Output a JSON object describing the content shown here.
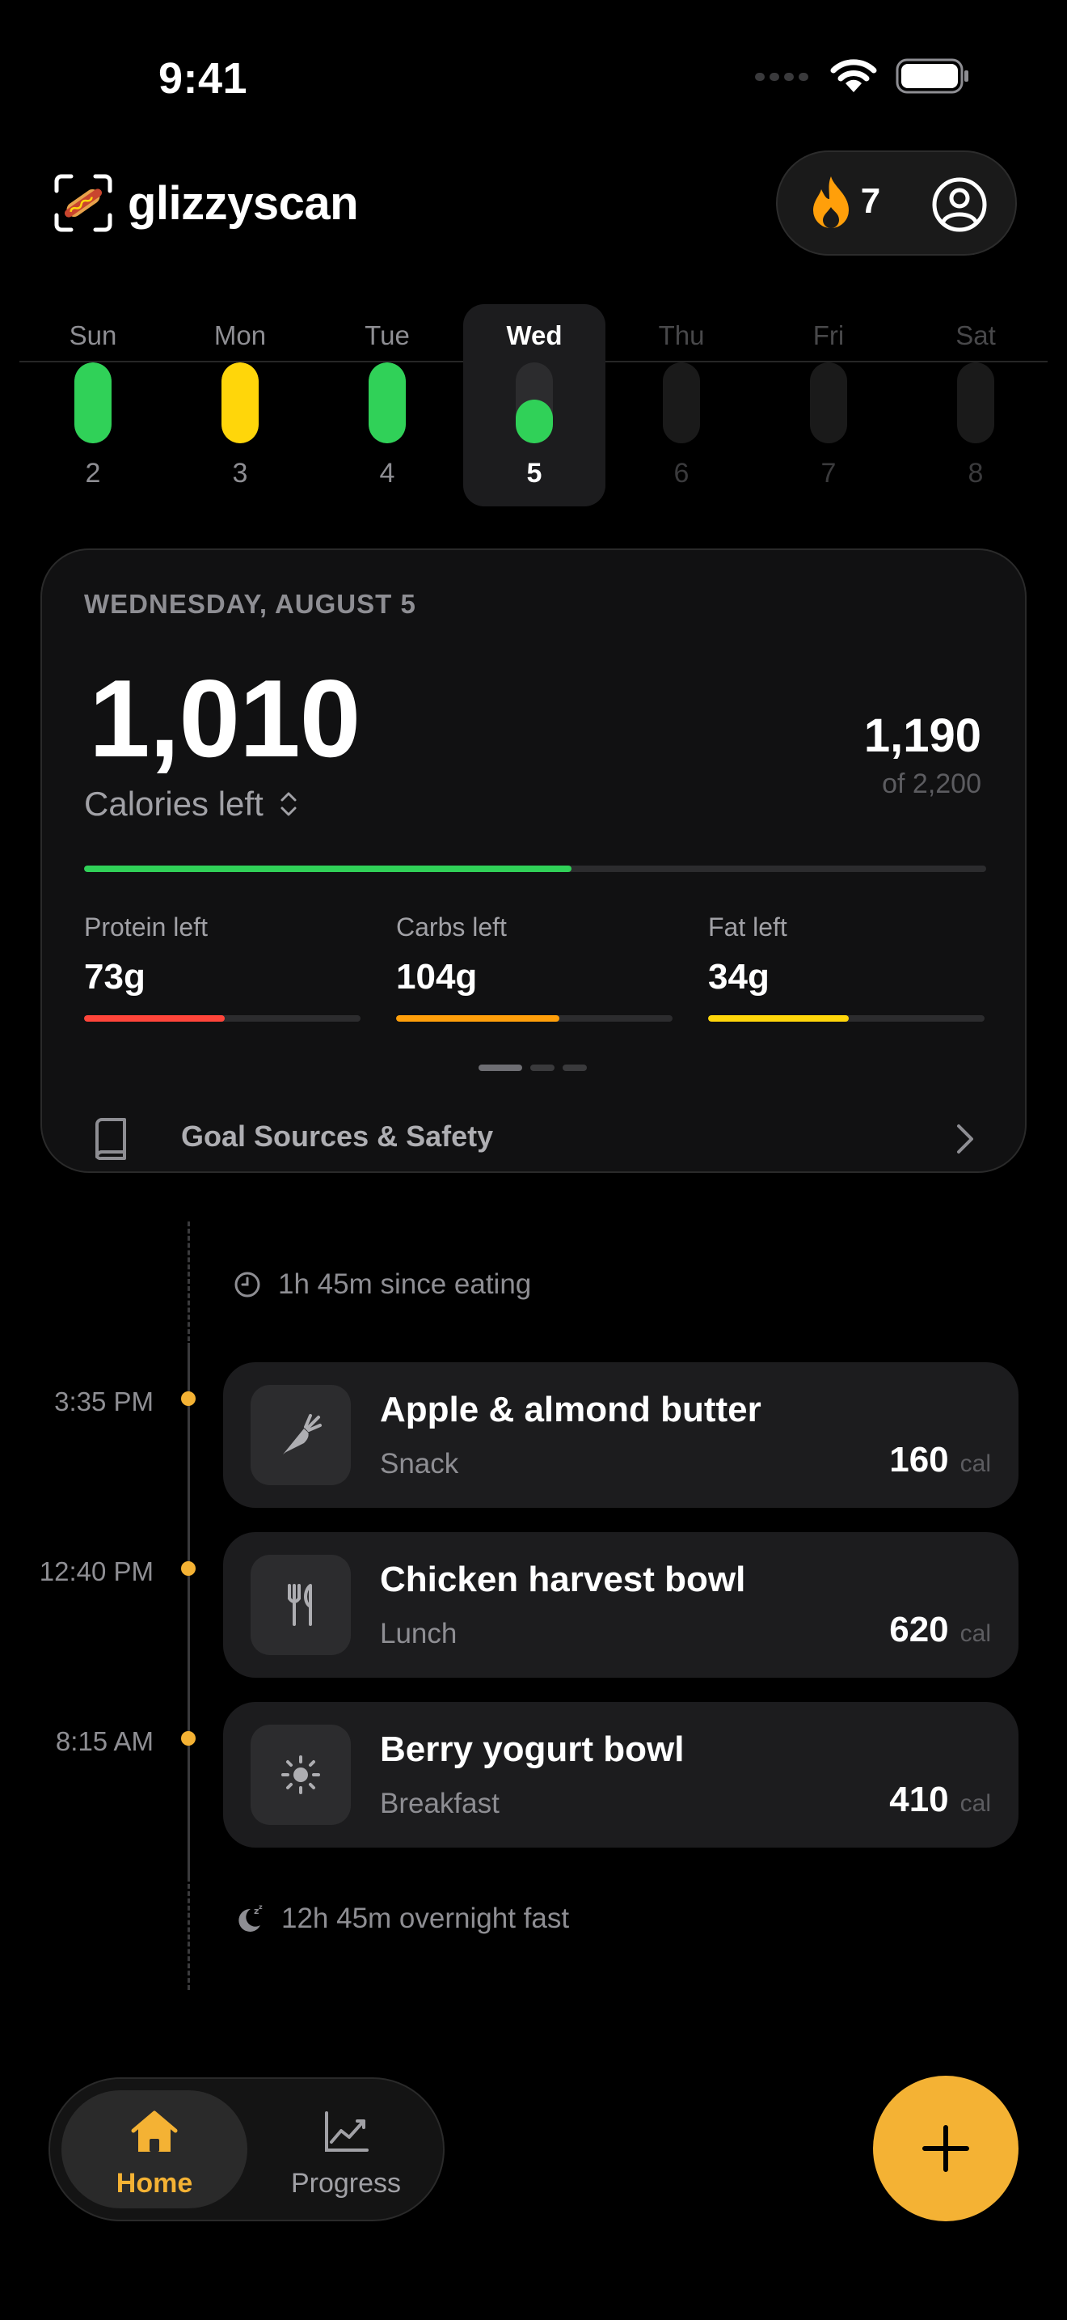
{
  "status_bar": {
    "time": "9:41"
  },
  "header": {
    "app_name": "glizzyscan",
    "streak_count": "7"
  },
  "week": [
    {
      "name": "Sun",
      "num": "2",
      "fill": 1.0,
      "color": "#30d158",
      "state": "past"
    },
    {
      "name": "Mon",
      "num": "3",
      "fill": 1.0,
      "color": "#ffd60a",
      "state": "past"
    },
    {
      "name": "Tue",
      "num": "4",
      "fill": 1.0,
      "color": "#30d158",
      "state": "past"
    },
    {
      "name": "Wed",
      "num": "5",
      "fill": 0.54,
      "color": "#30d158",
      "state": "selected"
    },
    {
      "name": "Thu",
      "num": "6",
      "fill": 0,
      "color": "#30d158",
      "state": "future"
    },
    {
      "name": "Fri",
      "num": "7",
      "fill": 0,
      "color": "#30d158",
      "state": "future"
    },
    {
      "name": "Sat",
      "num": "8",
      "fill": 0,
      "color": "#30d158",
      "state": "future"
    }
  ],
  "summary": {
    "date": "WEDNESDAY, AUGUST 5",
    "calories_left": "1,010",
    "calories_left_label": "Calories left",
    "calories_eaten": "1,190",
    "calories_goal": "of 2,200",
    "calories_progress": 0.54,
    "macros": [
      {
        "label": "Protein left",
        "value": "73g",
        "progress": 0.51,
        "color": "#ff453a"
      },
      {
        "label": "Carbs left",
        "value": "104g",
        "progress": 0.59,
        "color": "#ff9f0a"
      },
      {
        "label": "Fat left",
        "value": "34g",
        "progress": 0.51,
        "color": "#ffd60a"
      }
    ],
    "goal_sources_label": "Goal Sources & Safety"
  },
  "timeline": {
    "since_eating": "1h 45m since eating",
    "meals": [
      {
        "time": "3:35 PM",
        "name": "Apple & almond butter",
        "type": "Snack",
        "calories": "160",
        "unit": "cal",
        "icon": "carrot-icon"
      },
      {
        "time": "12:40 PM",
        "name": "Chicken harvest bowl",
        "type": "Lunch",
        "calories": "620",
        "unit": "cal",
        "icon": "fork-knife-icon"
      },
      {
        "time": "8:15 AM",
        "name": "Berry yogurt bowl",
        "type": "Breakfast",
        "calories": "410",
        "unit": "cal",
        "icon": "sun-icon"
      }
    ],
    "overnight_fast": "12h 45m overnight fast"
  },
  "nav": {
    "home_label": "Home",
    "progress_label": "Progress"
  },
  "colors": {
    "accent": "#f4b234",
    "green": "#30d158"
  }
}
